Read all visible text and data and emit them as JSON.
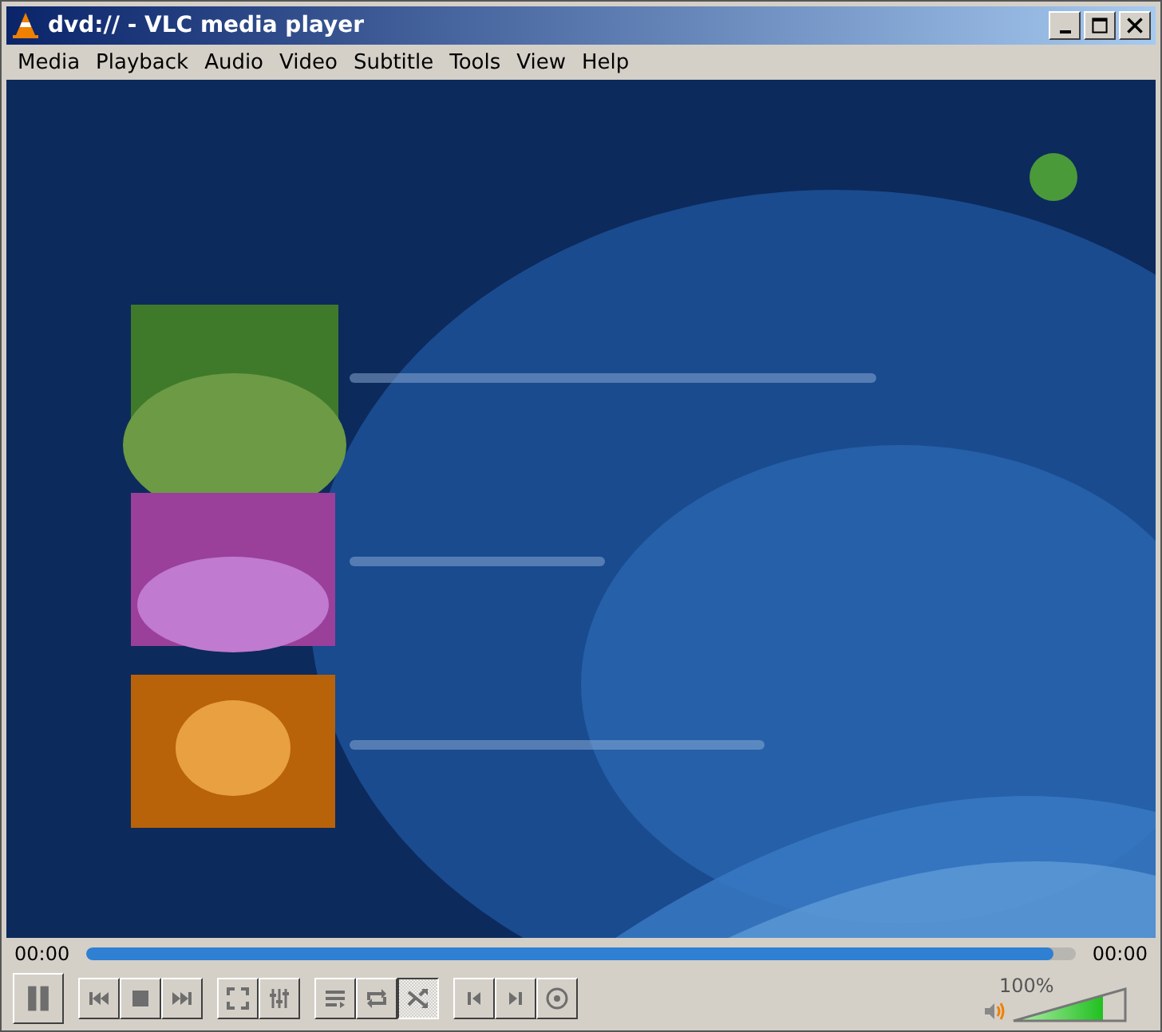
{
  "window": {
    "title": "dvd:// - VLC media player"
  },
  "menu": [
    {
      "label": "Media"
    },
    {
      "label": "Playback"
    },
    {
      "label": "Audio"
    },
    {
      "label": "Video"
    },
    {
      "label": "Subtitle"
    },
    {
      "label": "Tools"
    },
    {
      "label": "View"
    },
    {
      "label": "Help"
    }
  ],
  "seek": {
    "elapsed": "00:00",
    "total": "00:00",
    "level": 0.977
  },
  "controls": {
    "loop_on": false,
    "random_on": true
  },
  "volume": {
    "reading": "100%",
    "level": 0.8
  }
}
